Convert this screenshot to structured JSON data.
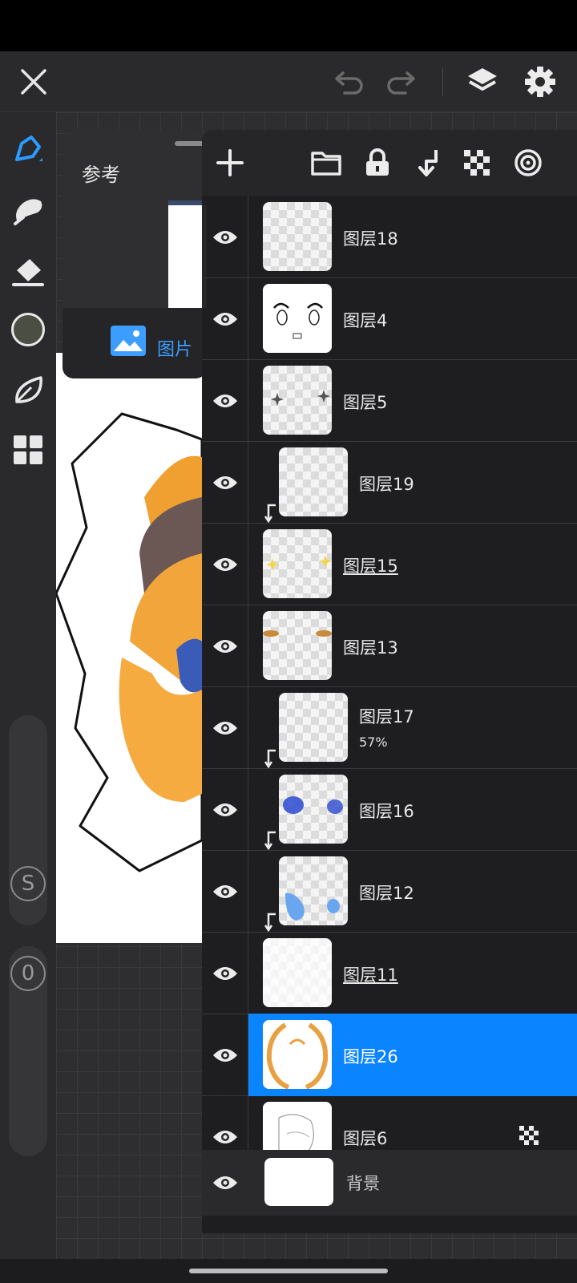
{
  "topbar": {
    "close_icon": "close-icon",
    "undo_icon": "undo-icon",
    "redo_icon": "redo-icon",
    "layers_icon": "layers-icon",
    "settings_icon": "gear-icon"
  },
  "left_toolbar": {
    "current_color": "#4b4e42",
    "stabilizer_label": "S",
    "opacity_label": "0"
  },
  "reference_panel": {
    "title": "参考",
    "image_button_label": "图片"
  },
  "layer_panel": {
    "layers": [
      {
        "name": "图层18",
        "underlined": false,
        "clipped": false,
        "opacity": ""
      },
      {
        "name": "图层4",
        "underlined": false,
        "clipped": false,
        "opacity": ""
      },
      {
        "name": "图层5",
        "underlined": false,
        "clipped": false,
        "opacity": ""
      },
      {
        "name": "图层19",
        "underlined": false,
        "clipped": true,
        "opacity": ""
      },
      {
        "name": "图层15",
        "underlined": true,
        "clipped": false,
        "opacity": ""
      },
      {
        "name": "图层13",
        "underlined": false,
        "clipped": false,
        "opacity": ""
      },
      {
        "name": "图层17",
        "underlined": false,
        "clipped": true,
        "opacity": "57%"
      },
      {
        "name": "图层16",
        "underlined": false,
        "clipped": true,
        "opacity": ""
      },
      {
        "name": "图层12",
        "underlined": false,
        "clipped": true,
        "opacity": ""
      },
      {
        "name": "图层11",
        "underlined": true,
        "clipped": false,
        "opacity": ""
      },
      {
        "name": "图层26",
        "underlined": false,
        "clipped": false,
        "opacity": "",
        "selected": true
      },
      {
        "name": "图层6",
        "underlined": false,
        "clipped": false,
        "opacity": ""
      }
    ],
    "background_layer": "背景",
    "accent_color": "#0a84ff"
  }
}
